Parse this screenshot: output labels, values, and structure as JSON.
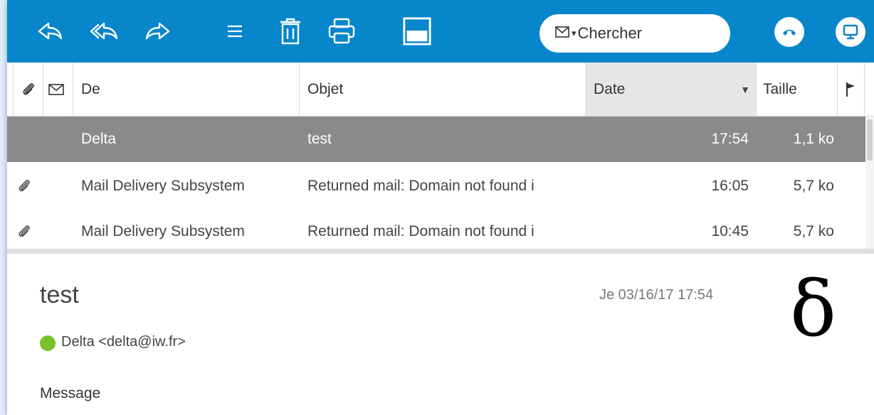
{
  "toolbar": {
    "buttons": [
      {
        "icon": "reply-icon"
      },
      {
        "icon": "reply-all-icon"
      },
      {
        "icon": "forward-icon"
      },
      {
        "icon": "menu-icon"
      },
      {
        "icon": "trash-icon"
      },
      {
        "icon": "print-icon"
      },
      {
        "icon": "layout-icon"
      }
    ],
    "search_placeholder": "Chercher",
    "search_caret": "▾",
    "accent_color": "#0786cc"
  },
  "columns": {
    "from": "De",
    "subject": "Objet",
    "date": "Date",
    "date_sort": "▼",
    "size": "Taille"
  },
  "messages": [
    {
      "from": "Delta",
      "subject": "test",
      "time": "17:54",
      "size": "1,1 ko",
      "attachment": false,
      "selected": true
    },
    {
      "from": "Mail Delivery Subsystem",
      "subject": "Returned mail: Domain not found i",
      "time": "16:05",
      "size": "5,7 ko",
      "attachment": true,
      "selected": false
    },
    {
      "from": "Mail Delivery Subsystem",
      "subject": "Returned mail: Domain not found i",
      "time": "10:45",
      "size": "5,7 ko",
      "attachment": true,
      "selected": false
    }
  ],
  "preview": {
    "subject": "test",
    "date": "Je 03/16/17 17:54",
    "avatar_glyph": "δ",
    "sender": "Delta <delta@iw.fr>",
    "status_color": "#78c22b",
    "body_label": "Message"
  }
}
